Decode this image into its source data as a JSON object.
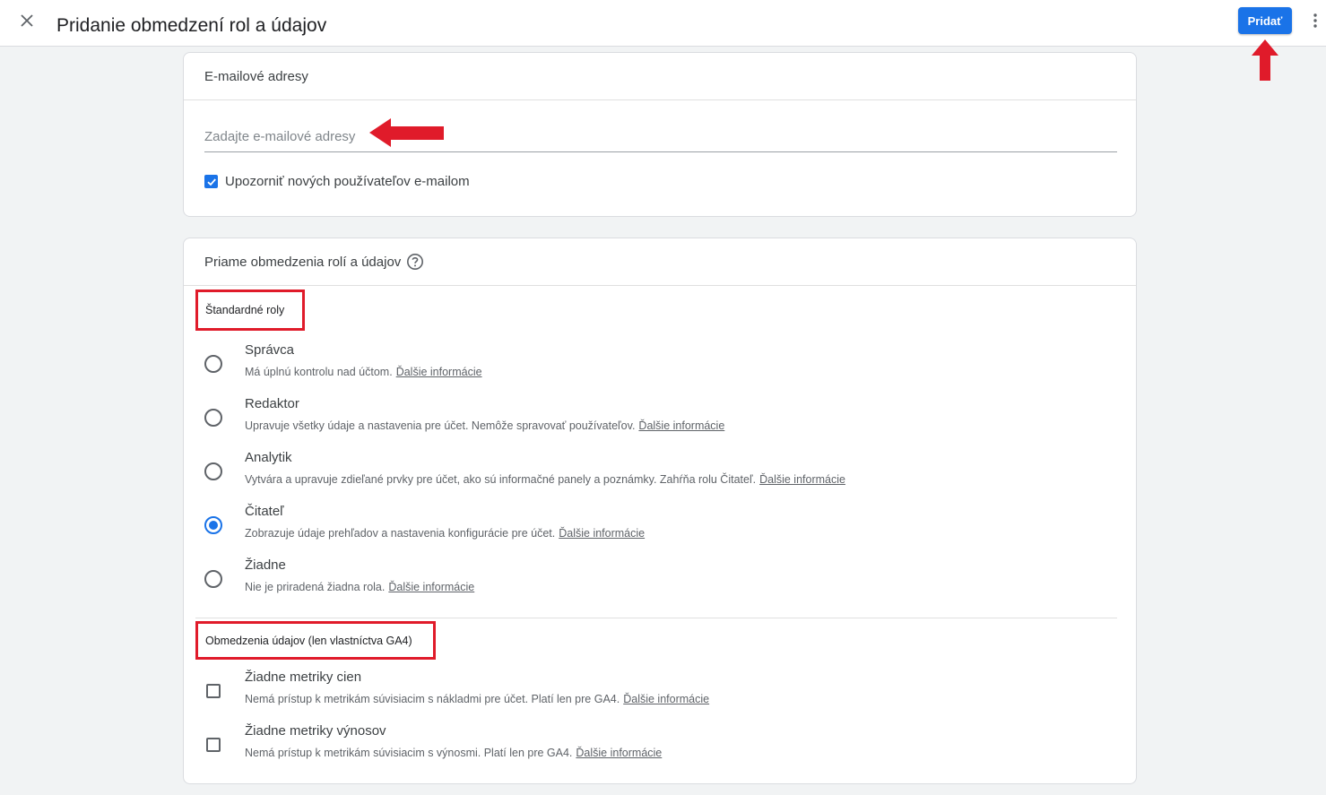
{
  "header": {
    "title": "Pridanie obmedzení rol a údajov",
    "add_label": "Pridať",
    "close_icon": "close-icon",
    "more_icon": "more-vert-icon"
  },
  "emails_card": {
    "title": "E-mailové adresy",
    "placeholder": "Zadajte e-mailové adresy",
    "value": "",
    "notify_label": "Upozorniť nových používateľov e-mailom",
    "notify_checked": true
  },
  "roles_card": {
    "title": "Priame obmedzenia rolí a údajov",
    "help_icon": "help-icon",
    "standard_label": "Štandardné roly",
    "roles": [
      {
        "title": "Správca",
        "desc": "Má úplnú kontrolu nad účtom.",
        "link": "Ďalšie informácie",
        "selected": false
      },
      {
        "title": "Redaktor",
        "desc": "Upravuje všetky údaje a nastavenia pre účet. Nemôže spravovať používateľov.",
        "link": "Ďalšie informácie",
        "selected": false
      },
      {
        "title": "Analytik",
        "desc": "Vytvára a upravuje zdieľané prvky pre účet, ako sú informačné panely a poznámky. Zahŕňa rolu Čitateľ.",
        "link": "Ďalšie informácie",
        "selected": false
      },
      {
        "title": "Čitateľ",
        "desc": "Zobrazuje údaje prehľadov a nastavenia konfigurácie pre účet.",
        "link": "Ďalšie informácie",
        "selected": true
      },
      {
        "title": "Žiadne",
        "desc": "Nie je priradená žiadna rola.",
        "link": "Ďalšie informácie",
        "selected": false
      }
    ],
    "data_label": "Obmedzenia údajov (len vlastníctva GA4)",
    "restrictions": [
      {
        "title": "Žiadne metriky cien",
        "desc": "Nemá prístup k metrikám súvisiacim s nákladmi pre účet. Platí len pre GA4.",
        "link": "Ďalšie informácie",
        "checked": false
      },
      {
        "title": "Žiadne metriky výnosov",
        "desc": "Nemá prístup k metrikám súvisiacim s výnosmi. Platí len pre GA4.",
        "link": "Ďalšie informácie",
        "checked": false
      }
    ]
  },
  "annotations": {
    "arrow_color": "#e01b2a",
    "accent_color": "#1a73e8"
  }
}
